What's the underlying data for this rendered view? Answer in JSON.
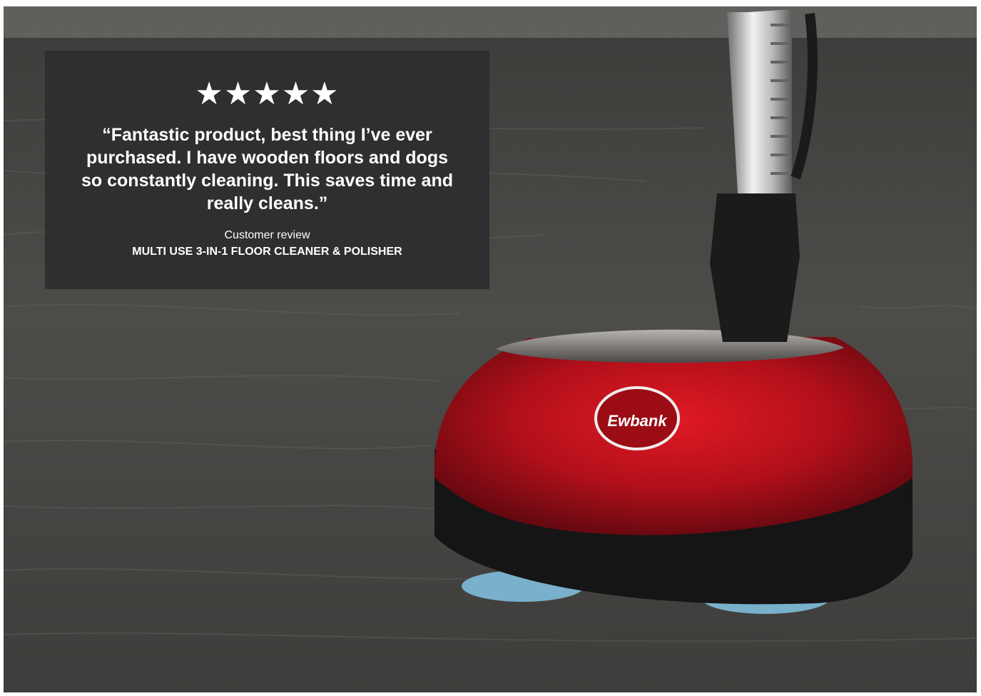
{
  "review": {
    "rating_stars": 5,
    "stars_text": "★★★★★",
    "quote": "“Fantastic product, best thing I’ve ever purchased. I have wooden floors and dogs so constantly cleaning. This saves time and really cleans.”",
    "label": "Customer review",
    "product": "MULTI USE 3-IN-1 FLOOR CLEANER & POLISHER"
  },
  "photo": {
    "logo_text": "Ewbank",
    "subject_icon": "floor-polisher",
    "colors": {
      "floor": "#4a4947",
      "polisher_body": "#b3101a",
      "polisher_base": "#151515",
      "pads": "#79b0cb",
      "card_background": "#2c2e30"
    }
  }
}
